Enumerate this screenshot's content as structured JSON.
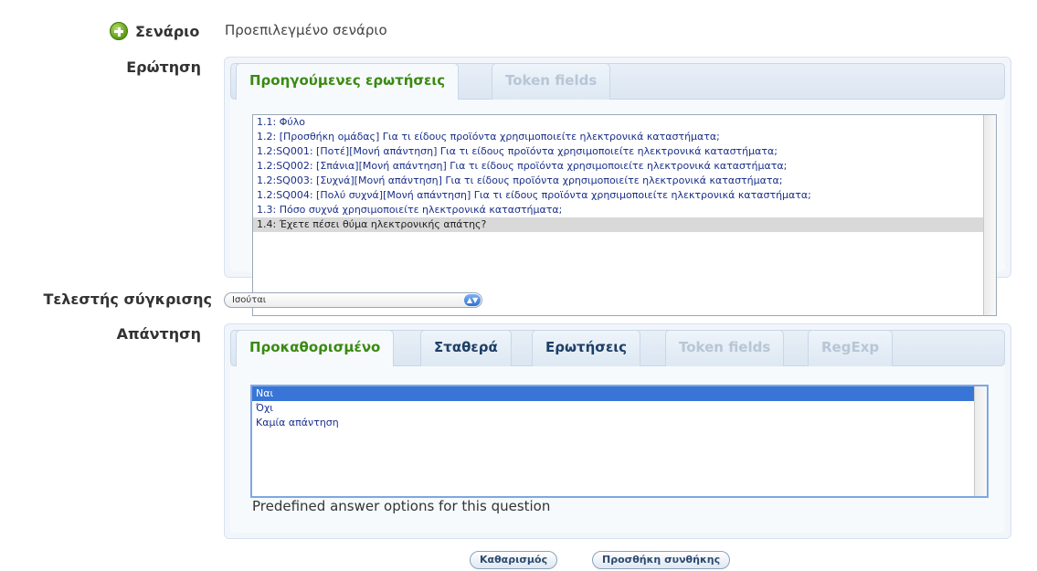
{
  "scenario": {
    "label": "Σενάριο",
    "value": "Προεπιλεγμένο σενάριο"
  },
  "question": {
    "label": "Ερώτηση",
    "tabs": [
      {
        "label": "Προηγούμενες ερωτήσεις",
        "active": true
      },
      {
        "label": "Token fields",
        "active": false,
        "disabled": true
      }
    ],
    "items": [
      "1.1:  Φύλο",
      "1.2:  [Προσθήκη ομάδας] Για τι είδους προϊόντα χρησιμοποιείτε ηλεκτρονικά καταστήματα;",
      "1.2:SQ001:  [Ποτέ][Μονή απάντηση] Για τι είδους προϊόντα χρησιμοποιείτε ηλεκτρονικά καταστήματα;",
      "1.2:SQ002:  [Σπάνια][Μονή απάντηση] Για τι είδους προϊόντα χρησιμοποιείτε ηλεκτρονικά καταστήματα;",
      "1.2:SQ003:  [Συχνά][Μονή απάντηση] Για τι είδους προϊόντα χρησιμοποιείτε ηλεκτρονικά καταστήματα;",
      "1.2:SQ004:  [Πολύ συχνά][Μονή απάντηση] Για τι είδους προϊόντα χρησιμοποιείτε ηλεκτρονικά καταστήματα;",
      "1.3:  Πόσο συχνά χρησιμοποιείτε ηλεκτρονικά καταστήματα;",
      "1.4:  Έχετε πέσει θύμα ηλεκτρονικής απάτης?"
    ],
    "selected_index": 7
  },
  "comparison": {
    "label": "Τελεστής σύγκρισης",
    "value": "Ισούται"
  },
  "answer": {
    "label": "Απάντηση",
    "tabs": [
      {
        "label": "Προκαθορισμένο",
        "active": true
      },
      {
        "label": "Σταθερά",
        "active": false
      },
      {
        "label": "Ερωτήσεις",
        "active": false
      },
      {
        "label": "Token fields",
        "active": false,
        "disabled": true
      },
      {
        "label": "RegExp",
        "active": false,
        "disabled": true
      }
    ],
    "options": [
      "Ναι",
      "Όχι",
      "Καμία απάντηση"
    ],
    "selected_index": 0,
    "hint": "Predefined answer options for this question"
  },
  "buttons": {
    "clear": "Καθαρισμός",
    "add_condition": "Προσθήκη συνθήκης"
  },
  "colors": {
    "active_tab_text": "#3a8a12",
    "tab_text": "#1e3f66",
    "disabled_tab_text": "#b7c6d6",
    "selection_blue": "#3875d7"
  }
}
